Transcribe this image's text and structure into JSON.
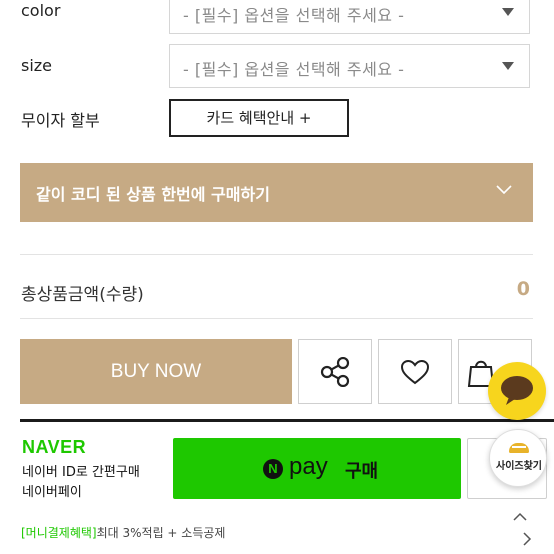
{
  "options": {
    "color_label": "color",
    "color_placeholder": "- [필수] 옵션을 선택해 주세요 -",
    "size_label": "size",
    "size_placeholder": "- [필수] 옵션을 선택해 주세요 -"
  },
  "installment": {
    "label": "무이자 할부",
    "card_button": "카드 혜택안내 +"
  },
  "coordi": {
    "label": "같이 코디 된 상품 한번에 구매하기",
    "icon": "chevron-down-icon"
  },
  "total": {
    "label": "총상품금액(수량)",
    "value": "0"
  },
  "actions": {
    "buy_now": "BUY NOW",
    "share_icon": "share-icon",
    "wishlist_icon": "heart-icon",
    "cart_icon": "shopping-bag-icon"
  },
  "naver": {
    "logo": "NAVER",
    "line1": "네이버 ID로 간편구매",
    "line2": "네이버페이",
    "pay_n": "N",
    "pay_word": "pay",
    "pay_buy": "구매",
    "benefit_tag": "[머니결제혜택]",
    "benefit_text": "최대 3%적립 + 소득공제"
  },
  "floating": {
    "chat_icon": "chat-bubble-icon",
    "size_label": "사이즈찾기"
  },
  "colors": {
    "accent": "#c6aa84",
    "naver_green": "#1ec800",
    "chat_yellow": "#f7d51d"
  }
}
